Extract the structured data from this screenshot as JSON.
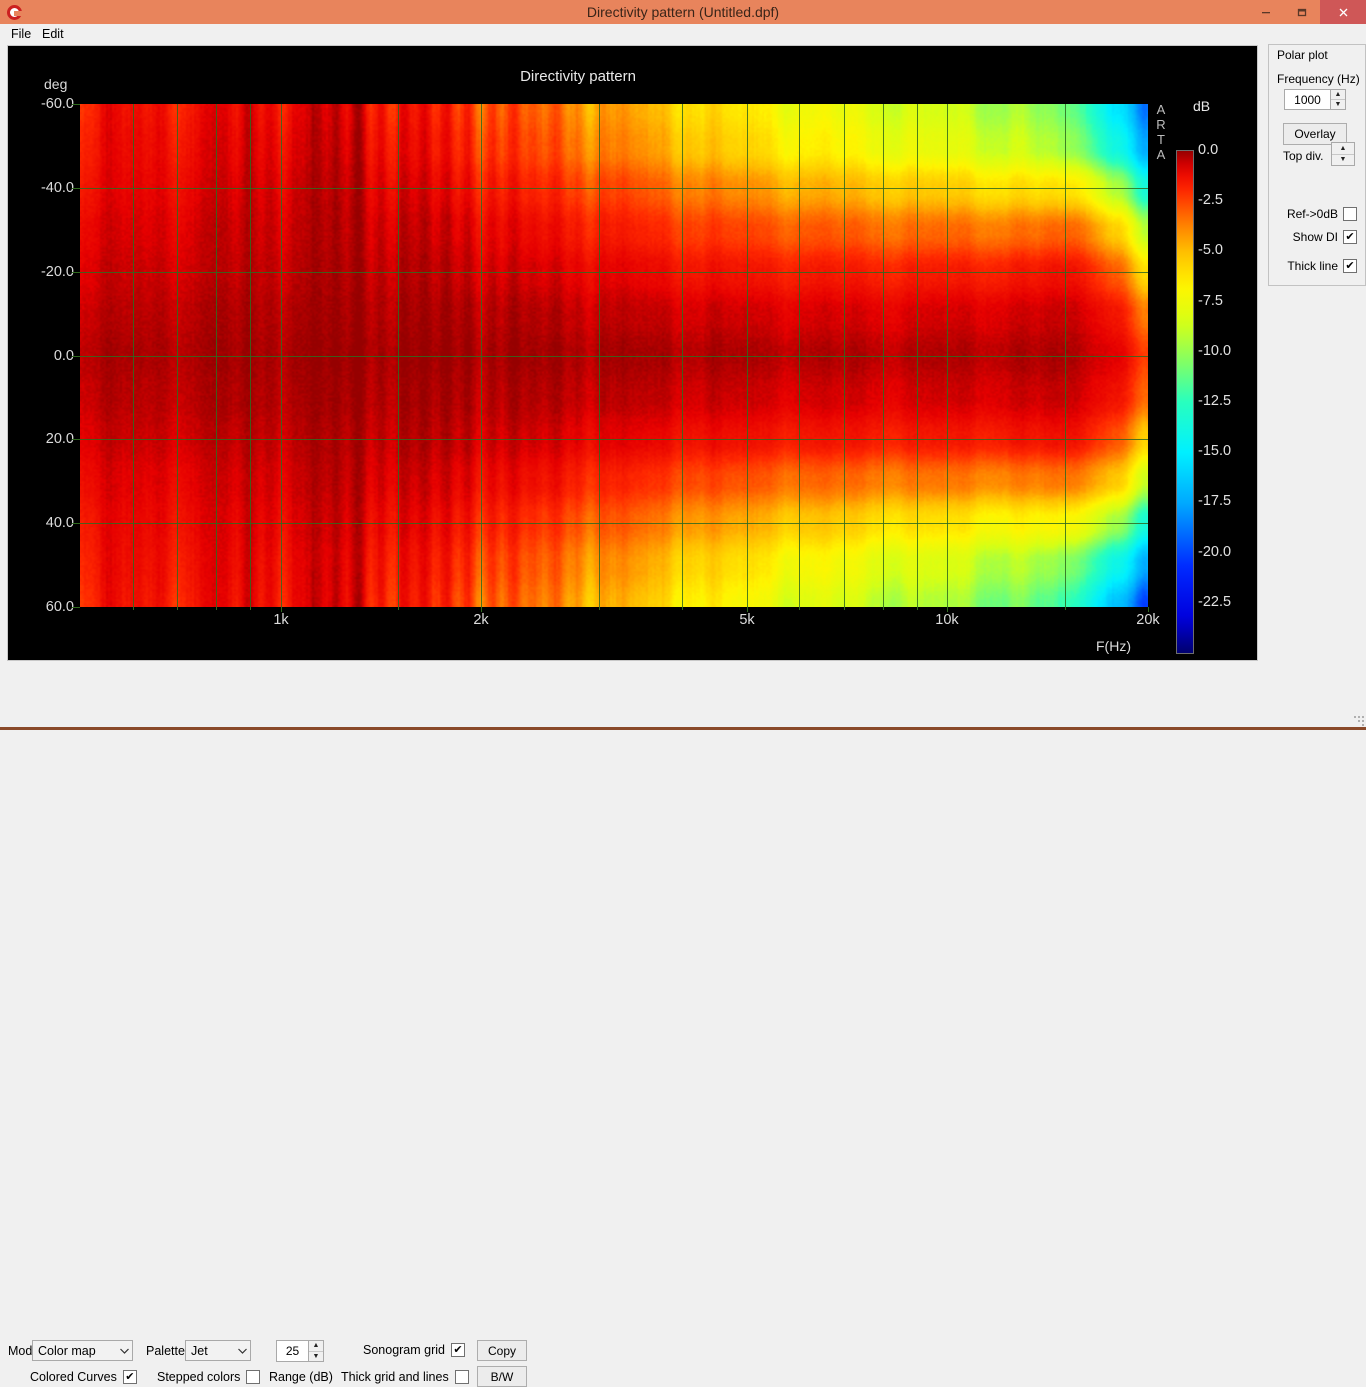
{
  "window": {
    "title": "Directivity pattern (Untitled.dpf)",
    "icon": "arta-logo-icon",
    "titlebar_color": "#e8845c",
    "minimize": "–",
    "maximize": "❐",
    "close": "×"
  },
  "menubar": {
    "items": [
      {
        "label": "File"
      },
      {
        "label": "Edit"
      }
    ]
  },
  "plot": {
    "title": "Directivity pattern",
    "y_unit": "deg",
    "x_unit": "F(Hz)",
    "cbar_unit": "dB",
    "watermark": "ARTA",
    "background": "#000000",
    "grid_color": "#2f6a1e"
  },
  "side_panel": {
    "title": "Polar plot",
    "frequency_label": "Frequency (Hz)",
    "frequency_value": "1000",
    "overlay_button": "Overlay",
    "top_div_label": "Top div.",
    "checkboxes": [
      {
        "label": "Ref->0dB",
        "checked": false
      },
      {
        "label": "Show DI",
        "checked": true
      },
      {
        "label": "Thick line",
        "checked": true
      }
    ],
    "spinner_up": "▲",
    "spinner_down": "▼",
    "check_glyph": "✔"
  },
  "toolbar": {
    "mode_label": "Mode",
    "mode_value": "Color map",
    "palette_label": "Palette",
    "palette_value": "Jet",
    "range_value": "25",
    "range_label": "Range (dB)",
    "colored_curves_label": "Colored Curves",
    "colored_curves_checked": true,
    "stepped_colors_label": "Stepped colors",
    "stepped_colors_checked": false,
    "sonogram_grid_label": "Sonogram grid",
    "sonogram_grid_checked": true,
    "thick_grid_label": "Thick grid and  lines",
    "thick_grid_checked": false,
    "copy_button": "Copy",
    "bw_button": "B/W",
    "combo_arrow": "⌄",
    "check_glyph": "✔"
  },
  "chart_data": {
    "type": "heatmap",
    "title": "Directivity pattern",
    "xlabel": "F(Hz)",
    "ylabel": "deg",
    "zlabel": "dB",
    "xscale": "log",
    "xlim": [
      500,
      20000
    ],
    "ylim": [
      -60,
      60
    ],
    "zlim": [
      -25,
      0
    ],
    "grid": true,
    "legend": "colorbar-right",
    "palette": "Jet",
    "xticks": [
      {
        "value": 1000,
        "label": "1k"
      },
      {
        "value": 2000,
        "label": "2k"
      },
      {
        "value": 5000,
        "label": "5k"
      },
      {
        "value": 10000,
        "label": "10k"
      },
      {
        "value": 20000,
        "label": "20k"
      }
    ],
    "yticks": [
      {
        "value": -60,
        "label": "-60.0"
      },
      {
        "value": -40,
        "label": "-40.0"
      },
      {
        "value": -20,
        "label": "-20.0"
      },
      {
        "value": 0,
        "label": "0.0"
      },
      {
        "value": 20,
        "label": "20.0"
      },
      {
        "value": 40,
        "label": "40.0"
      },
      {
        "value": 60,
        "label": "60.0"
      }
    ],
    "colorbar_ticks": [
      {
        "value": 0.0,
        "label": "0.0"
      },
      {
        "value": -2.5,
        "label": "-2.5"
      },
      {
        "value": -5.0,
        "label": "-5.0"
      },
      {
        "value": -7.5,
        "label": "-7.5"
      },
      {
        "value": -10.0,
        "label": "-10.0"
      },
      {
        "value": -12.5,
        "label": "-12.5"
      },
      {
        "value": -15.0,
        "label": "-15.0"
      },
      {
        "value": -17.5,
        "label": "-17.5"
      },
      {
        "value": -20.0,
        "label": "-20.0"
      },
      {
        "value": -22.5,
        "label": "-22.5"
      }
    ],
    "x": [
      500,
      630,
      800,
      1000,
      1250,
      1600,
      2000,
      2500,
      3150,
      4000,
      5000,
      6300,
      8000,
      10000,
      12500,
      16000,
      18000,
      20000
    ],
    "y": [
      -60,
      -50,
      -40,
      -30,
      -20,
      -10,
      0,
      10,
      20,
      30,
      40,
      50,
      60
    ],
    "z": [
      [
        -1.6,
        -1.4,
        -1.2,
        -1.0,
        -0.9,
        -1.6,
        -2.4,
        -3.3,
        -4.4,
        -5.6,
        -6.6,
        -7.4,
        -8.2,
        -8.8,
        -9.6,
        -11.5,
        -15.5,
        -19.0
      ],
      [
        -1.4,
        -1.2,
        -1.0,
        -0.8,
        -0.7,
        -1.3,
        -2.0,
        -2.8,
        -3.8,
        -4.9,
        -5.9,
        -6.7,
        -7.4,
        -8.0,
        -8.7,
        -10.3,
        -14.0,
        -17.5
      ],
      [
        -1.2,
        -1.0,
        -0.8,
        -0.6,
        -0.5,
        -0.9,
        -1.4,
        -2.0,
        -2.6,
        -3.4,
        -4.1,
        -4.7,
        -5.2,
        -5.6,
        -6.0,
        -6.4,
        -9.5,
        -13.5
      ],
      [
        -0.9,
        -0.8,
        -0.6,
        -0.5,
        -0.4,
        -0.6,
        -0.9,
        -1.3,
        -1.7,
        -2.2,
        -2.6,
        -2.9,
        -3.2,
        -3.3,
        -3.4,
        -3.2,
        -5.6,
        -9.2
      ],
      [
        -0.7,
        -0.6,
        -0.5,
        -0.4,
        -0.3,
        -0.4,
        -0.6,
        -0.8,
        -1.0,
        -1.3,
        -1.5,
        -1.6,
        -1.7,
        -1.7,
        -1.6,
        -1.4,
        -3.0,
        -6.0
      ],
      [
        -0.5,
        -0.4,
        -0.3,
        -0.25,
        -0.2,
        -0.25,
        -0.3,
        -0.4,
        -0.5,
        -0.6,
        -0.7,
        -0.75,
        -0.8,
        -0.75,
        -0.7,
        -0.6,
        -1.5,
        -3.6
      ],
      [
        -0.3,
        -0.25,
        -0.2,
        -0.15,
        -0.1,
        -0.12,
        -0.15,
        -0.18,
        -0.2,
        -0.25,
        -0.3,
        -0.32,
        -0.35,
        -0.33,
        -0.3,
        -0.3,
        -0.9,
        -2.4
      ],
      [
        -0.45,
        -0.4,
        -0.3,
        -0.25,
        -0.2,
        -0.25,
        -0.3,
        -0.38,
        -0.45,
        -0.55,
        -0.65,
        -0.7,
        -0.75,
        -0.7,
        -0.65,
        -0.6,
        -1.4,
        -3.2
      ],
      [
        -0.7,
        -0.6,
        -0.5,
        -0.4,
        -0.35,
        -0.4,
        -0.55,
        -0.75,
        -0.95,
        -1.2,
        -1.4,
        -1.5,
        -1.6,
        -1.6,
        -1.5,
        -1.4,
        -2.8,
        -5.6
      ],
      [
        -1.0,
        -0.9,
        -0.75,
        -0.6,
        -0.5,
        -0.7,
        -1.0,
        -1.4,
        -1.9,
        -2.4,
        -2.9,
        -3.2,
        -3.5,
        -3.6,
        -3.7,
        -3.6,
        -5.4,
        -8.8
      ],
      [
        -1.3,
        -1.1,
        -0.95,
        -0.8,
        -0.7,
        -1.1,
        -1.6,
        -2.3,
        -3.0,
        -3.9,
        -4.7,
        -5.3,
        -5.9,
        -6.3,
        -6.8,
        -7.2,
        -9.8,
        -13.4
      ],
      [
        -1.5,
        -1.3,
        -1.15,
        -1.0,
        -0.9,
        -1.5,
        -2.2,
        -3.1,
        -4.1,
        -5.3,
        -6.3,
        -7.1,
        -7.9,
        -8.5,
        -9.3,
        -10.8,
        -14.2,
        -17.4
      ],
      [
        -1.7,
        -1.5,
        -1.3,
        -1.1,
        -1.0,
        -1.8,
        -2.7,
        -3.7,
        -4.9,
        -6.2,
        -7.3,
        -8.2,
        -9.0,
        -9.7,
        -10.7,
        -12.8,
        -16.8,
        -20.3
      ]
    ]
  }
}
